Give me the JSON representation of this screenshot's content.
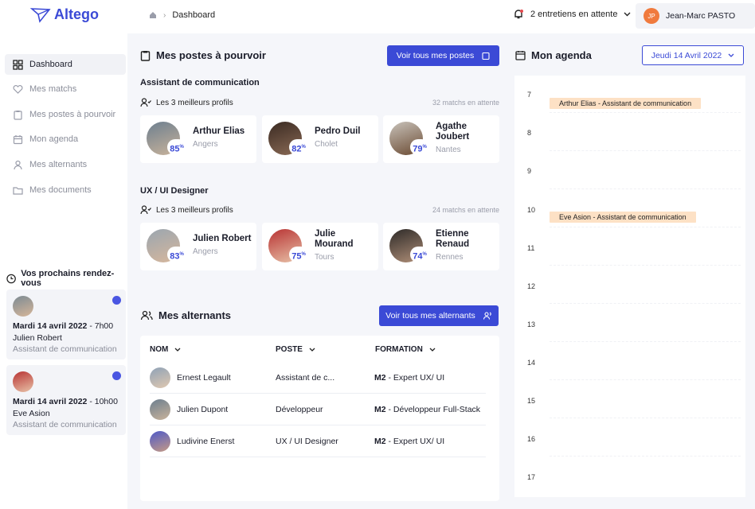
{
  "app": {
    "name": "Altego"
  },
  "breadcrumb": {
    "current": "Dashboard"
  },
  "header": {
    "notifications": "2 entretiens en attente",
    "user_initials": "JP",
    "user_name": "Jean-Marc PASTO"
  },
  "sidebar": {
    "items": [
      {
        "label": "Dashboard",
        "icon": "grid-icon"
      },
      {
        "label": "Mes matchs",
        "icon": "heart-icon"
      },
      {
        "label": "Mes postes à pourvoir",
        "icon": "clipboard-icon"
      },
      {
        "label": "Mon agenda",
        "icon": "calendar-icon"
      },
      {
        "label": "Mes alternants",
        "icon": "user-icon"
      },
      {
        "label": "Mes documents",
        "icon": "folder-icon"
      }
    ],
    "rdv_title": "Vos prochains rendez-vous",
    "rdv": [
      {
        "date": "Mardi 14 avril 2022",
        "time": " - 7h00",
        "name": "Julien Robert",
        "role": "Assistant de communication"
      },
      {
        "date": "Mardi 14 avril 2022",
        "time": " - 10h00",
        "name": "Eve Asion",
        "role": "Assistant de communication"
      }
    ]
  },
  "postes": {
    "title": "Mes postes à pourvoir",
    "button": "Voir tous mes postes",
    "jobs": [
      {
        "title": "Assistant de communication",
        "best_label": "Les 3 meilleurs profils",
        "pending": "32 matchs en attente",
        "profiles": [
          {
            "name": "Arthur Elias",
            "city": "Angers",
            "pct": "85"
          },
          {
            "name": "Pedro Duil",
            "city": "Cholet",
            "pct": "82"
          },
          {
            "name": "Agathe Joubert",
            "city": "Nantes",
            "pct": "79"
          }
        ]
      },
      {
        "title": "UX / UI Designer",
        "best_label": "Les 3 meilleurs profils",
        "pending": "24 matchs en attente",
        "profiles": [
          {
            "name": "Julien Robert",
            "city": "Angers",
            "pct": "83"
          },
          {
            "name": "Julie Mourand",
            "city": "Tours",
            "pct": "75"
          },
          {
            "name": "Etienne Renaud",
            "city": "Rennes",
            "pct": "74"
          }
        ]
      }
    ],
    "pct_suffix": "%"
  },
  "alternants": {
    "title": "Mes alternants",
    "button": "Voir tous mes alternants",
    "columns": [
      "NOM",
      "POSTE",
      "FORMATION"
    ],
    "rows": [
      {
        "name": "Ernest Legault",
        "poste": "Assistant de c...",
        "level": "M2",
        "formation": " - Expert UX/ UI"
      },
      {
        "name": "Julien Dupont",
        "poste": "Développeur",
        "level": "M2",
        "formation": " - Développeur Full-Stack"
      },
      {
        "name": "Ludivine Enerst",
        "poste": "UX / UI Designer",
        "level": "M2",
        "formation": " - Expert UX/ UI"
      }
    ]
  },
  "agenda": {
    "title": "Mon agenda",
    "date": "Jeudi 14 Avril 2022",
    "hours": [
      "7",
      "8",
      "9",
      "10",
      "11",
      "12",
      "13",
      "14",
      "15",
      "16",
      "17"
    ],
    "events": [
      {
        "hour": "7",
        "label": "Arthur Elias - Assistant de communication"
      },
      {
        "hour": "10",
        "label": "Eve Asion - Assistant de communication"
      }
    ]
  },
  "colors": {
    "accent": "#3b4ad6",
    "event": "#fde1c5",
    "avatar": "#f07a3d"
  }
}
